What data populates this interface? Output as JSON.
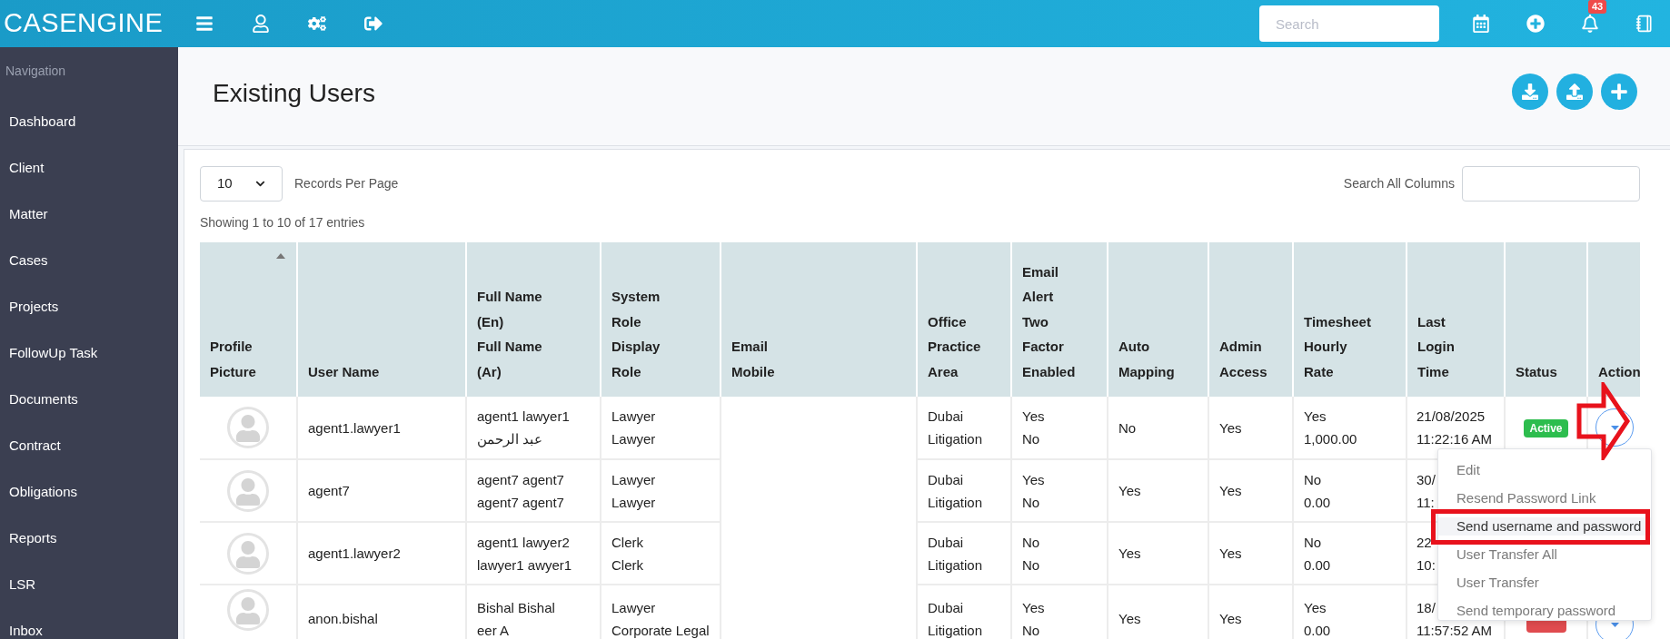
{
  "topbar": {
    "logo": "CASENGINE",
    "search_placeholder": "Search",
    "notification_count": "43"
  },
  "sidebar": {
    "heading": "Navigation",
    "items": [
      "Dashboard",
      "Client",
      "Matter",
      "Cases",
      "Projects",
      "FollowUp Task",
      "Documents",
      "Contract",
      "Obligations",
      "Reports",
      "LSR",
      "Inbox"
    ]
  },
  "page": {
    "title": "Existing Users"
  },
  "controls": {
    "page_size": "10",
    "page_size_label": "Records Per Page",
    "search_label": "Search All Columns",
    "info": "Showing 1 to 10 of 17 entries"
  },
  "table": {
    "columns": [
      {
        "lines": [
          "Profile",
          "Picture"
        ],
        "sorted": true
      },
      {
        "lines": [
          "User Name"
        ],
        "sorted": false
      },
      {
        "lines": [
          "Full Name",
          "(En)",
          "Full Name",
          "(Ar)"
        ],
        "sorted": false
      },
      {
        "lines": [
          "System",
          "Role",
          "Display",
          "Role"
        ],
        "sorted": false
      },
      {
        "lines": [
          "Email",
          "Mobile"
        ],
        "sorted": false
      },
      {
        "lines": [
          "Office",
          "Practice",
          "Area"
        ],
        "sorted": false
      },
      {
        "lines": [
          "Email",
          "Alert",
          "Two",
          "Factor",
          "Enabled"
        ],
        "sorted": false
      },
      {
        "lines": [
          "Auto",
          "Mapping"
        ],
        "sorted": false
      },
      {
        "lines": [
          "Admin",
          "Access"
        ],
        "sorted": false
      },
      {
        "lines": [
          "Timesheet",
          "Hourly",
          "Rate"
        ],
        "sorted": false
      },
      {
        "lines": [
          "Last",
          "Login",
          "Time"
        ],
        "sorted": false
      },
      {
        "lines": [
          "Status"
        ],
        "sorted": false
      },
      {
        "lines": [
          "Action"
        ],
        "sorted": false
      }
    ],
    "rows": [
      {
        "user_name": "agent1.lawyer1",
        "full_name": [
          "agent1 lawyer1",
          "عبد الرحمن"
        ],
        "role": [
          "Lawyer",
          "Lawyer"
        ],
        "office": [
          "Dubai",
          "Litigation"
        ],
        "email_alert": [
          "Yes",
          "No"
        ],
        "auto_mapping": "No",
        "admin_access": "Yes",
        "timesheet": [
          "Yes",
          "1,000.00"
        ],
        "last_login": [
          "21/08/2025",
          "11:22:16 AM"
        ],
        "status": {
          "kind": "active",
          "label": "Active"
        },
        "action_button": true
      },
      {
        "user_name": "agent7",
        "full_name": [
          "agent7 agent7",
          "agent7 agent7"
        ],
        "role": [
          "Lawyer",
          "Lawyer"
        ],
        "office": [
          "Dubai",
          "Litigation"
        ],
        "email_alert": [
          "Yes",
          "No"
        ],
        "auto_mapping": "Yes",
        "admin_access": "Yes",
        "timesheet": [
          "No",
          "0.00"
        ],
        "last_login": [
          "30/",
          "11:"
        ]
      },
      {
        "user_name": "agent1.lawyer2",
        "full_name": [
          "agent1 lawyer2",
          "lawyer1 awyer1"
        ],
        "role": [
          "Clerk",
          "Clerk"
        ],
        "office": [
          "Dubai",
          "Litigation"
        ],
        "email_alert": [
          "No",
          "No"
        ],
        "auto_mapping": "Yes",
        "admin_access": "Yes",
        "timesheet": [
          "No",
          "0.00"
        ],
        "last_login": [
          "22",
          "10:"
        ]
      },
      {
        "user_name": "anon.bishal",
        "full_name": [
          "Bishal Bishal",
          "eer A"
        ],
        "role": [
          "Lawyer",
          "Corporate Legal"
        ],
        "office": [
          "Dubai",
          "Litigation"
        ],
        "email_alert": [
          "Yes",
          "No"
        ],
        "auto_mapping": "Yes",
        "admin_access": "Yes",
        "timesheet": [
          "Yes",
          "0.00"
        ],
        "last_login": [
          "18/",
          "11:57:52 AM"
        ],
        "status": {
          "kind": "inactive"
        },
        "action_button": true
      }
    ]
  },
  "action_menu": {
    "items": [
      {
        "label": "Edit",
        "selected": false
      },
      {
        "label": "Resend Password Link",
        "selected": false
      },
      {
        "label": "Send username and password",
        "selected": true
      },
      {
        "label": "User Transfer All",
        "selected": false
      },
      {
        "label": "User Transfer",
        "selected": false
      },
      {
        "label": "Send temporary password",
        "selected": false
      }
    ]
  },
  "annotations": {
    "arrow": true,
    "highlight": true
  }
}
